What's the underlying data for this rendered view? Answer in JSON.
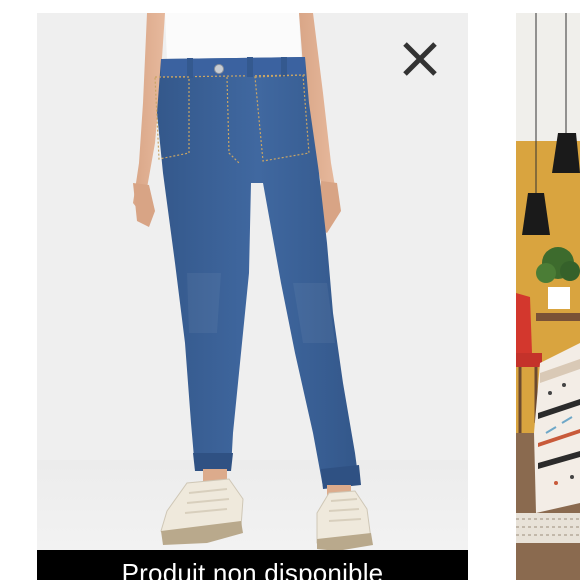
{
  "product_card": {
    "status_banner": "Produit non disponible",
    "close_icon": "close-x-icon",
    "image_subject": "jeans-jogger-photo"
  },
  "next_card": {
    "image_subject": "bedroom-decor-photo"
  },
  "colors": {
    "card_background": "#efefef",
    "banner_background": "#000000",
    "banner_text": "#ffffff",
    "close_icon": "#333333",
    "denim": "#3a5f93"
  }
}
